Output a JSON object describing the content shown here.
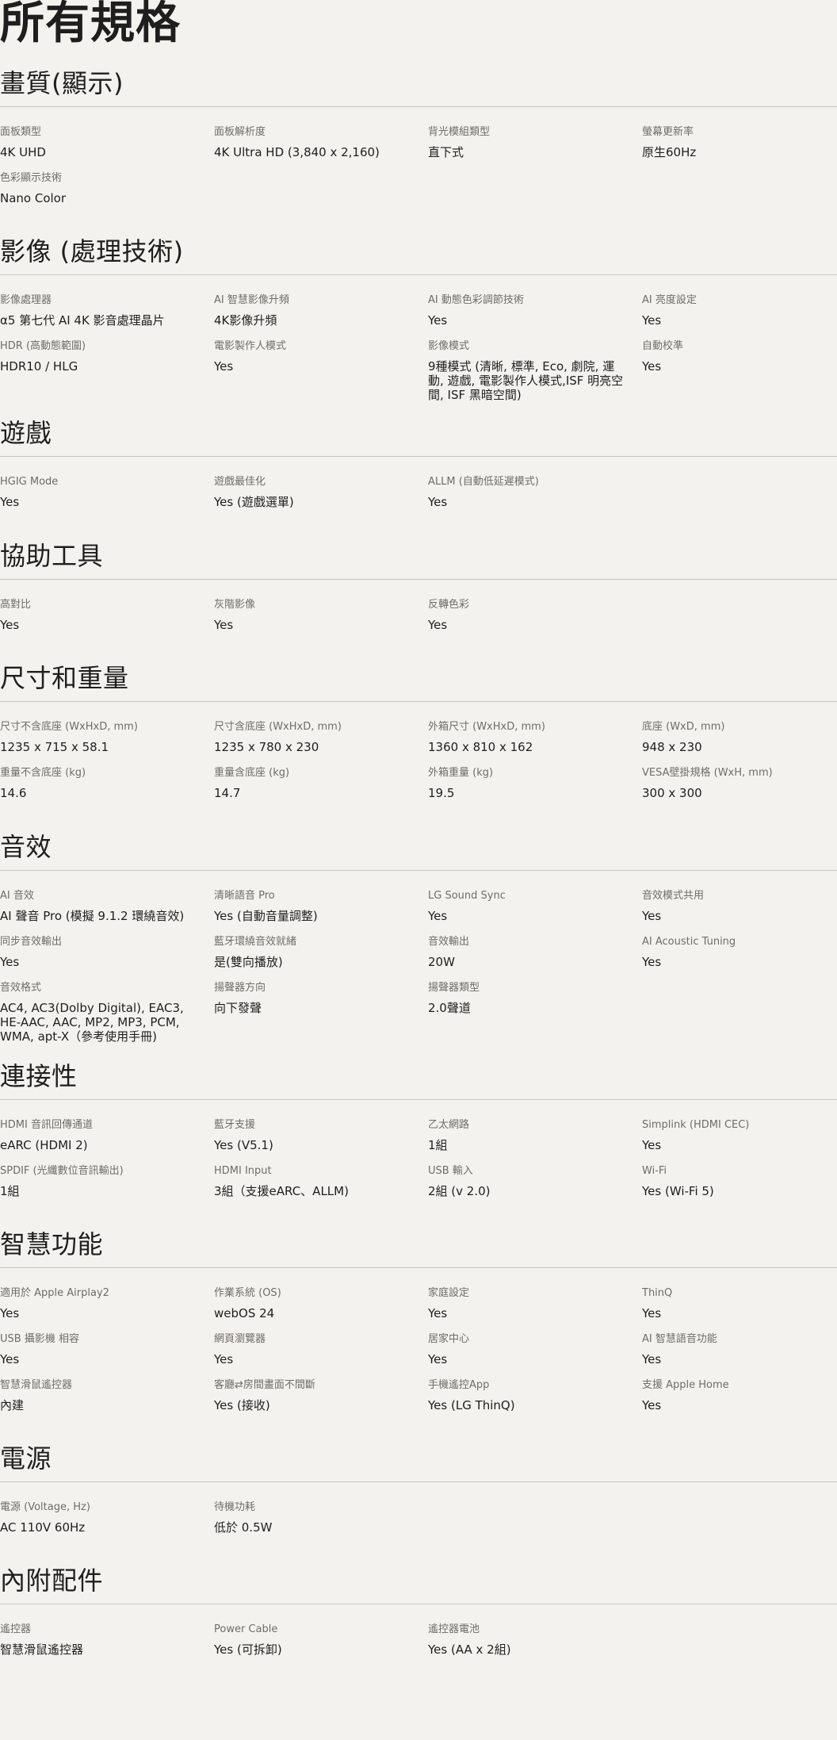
{
  "page_title": "所有規格",
  "sections": [
    {
      "title": "畫質(顯示)",
      "items": [
        {
          "label": "面板類型",
          "value": "4K UHD"
        },
        {
          "label": "面板解析度",
          "value": "4K Ultra HD (3,840 x 2,160)"
        },
        {
          "label": "背光模組類型",
          "value": "直下式"
        },
        {
          "label": "螢幕更新率",
          "value": "原生60Hz"
        },
        {
          "label": "色彩顯示技術",
          "value": "Nano Color"
        }
      ]
    },
    {
      "title": "影像 (處理技術)",
      "items": [
        {
          "label": "影像處理器",
          "value": "α5 第七代 AI 4K 影音處理晶片"
        },
        {
          "label": "AI 智慧影像升頻",
          "value": "4K影像升頻"
        },
        {
          "label": "AI 動態色彩調節技術",
          "value": "Yes"
        },
        {
          "label": "AI 亮度設定",
          "value": "Yes"
        },
        {
          "label": "HDR (高動態範圍)",
          "value": "HDR10 / HLG"
        },
        {
          "label": "電影製作人模式",
          "value": "Yes"
        },
        {
          "label": "影像模式",
          "value": "9種模式 (清晰, 標準, Eco, 劇院, 運動, 遊戲, 電影製作人模式,ISF 明亮空間, ISF 黑暗空間)"
        },
        {
          "label": "自動校準",
          "value": "Yes"
        }
      ]
    },
    {
      "title": "遊戲",
      "items": [
        {
          "label": "HGIG Mode",
          "value": "Yes"
        },
        {
          "label": "遊戲最佳化",
          "value": "Yes (遊戲選單)"
        },
        {
          "label": "ALLM (自動低延遲模式)",
          "value": "Yes"
        }
      ]
    },
    {
      "title": "協助工具",
      "items": [
        {
          "label": "高對比",
          "value": "Yes"
        },
        {
          "label": "灰階影像",
          "value": "Yes"
        },
        {
          "label": "反轉色彩",
          "value": "Yes"
        }
      ]
    },
    {
      "title": "尺寸和重量",
      "items": [
        {
          "label": "尺寸不含底座 (WxHxD, mm)",
          "value": "1235 x 715 x 58.1"
        },
        {
          "label": "尺寸含底座 (WxHxD, mm)",
          "value": "1235 x 780 x 230"
        },
        {
          "label": "外箱尺寸 (WxHxD, mm)",
          "value": "1360 x 810 x 162"
        },
        {
          "label": "底座 (WxD, mm)",
          "value": "948 x 230"
        },
        {
          "label": "重量不含底座 (kg)",
          "value": "14.6"
        },
        {
          "label": "重量含底座 (kg)",
          "value": "14.7"
        },
        {
          "label": "外箱重量 (kg)",
          "value": "19.5"
        },
        {
          "label": "VESA壁掛規格 (WxH, mm)",
          "value": "300 x 300"
        }
      ]
    },
    {
      "title": "音效",
      "items": [
        {
          "label": "AI 音效",
          "value": "AI 聲音 Pro (模擬 9.1.2 環繞音效)"
        },
        {
          "label": "清晰語音 Pro",
          "value": "Yes (自動音量調整)"
        },
        {
          "label": "LG Sound Sync",
          "value": "Yes"
        },
        {
          "label": "音效模式共用",
          "value": "Yes"
        },
        {
          "label": "同步音效輸出",
          "value": "Yes"
        },
        {
          "label": "藍牙環繞音效就緒",
          "value": "是(雙向播放)"
        },
        {
          "label": "音效輸出",
          "value": "20W"
        },
        {
          "label": "AI Acoustic Tuning",
          "value": "Yes"
        },
        {
          "label": "音效格式",
          "value": "AC4, AC3(Dolby Digital), EAC3, HE-AAC, AAC, MP2, MP3, PCM, WMA, apt-X（參考使用手冊)"
        },
        {
          "label": "揚聲器方向",
          "value": "向下發聲"
        },
        {
          "label": "揚聲器類型",
          "value": "2.0聲道"
        }
      ]
    },
    {
      "title": "連接性",
      "items": [
        {
          "label": "HDMI 音訊回傳通道",
          "value": "eARC (HDMI 2)"
        },
        {
          "label": "藍牙支援",
          "value": "Yes (V5.1)"
        },
        {
          "label": "乙太網路",
          "value": "1組"
        },
        {
          "label": "Simplink (HDMI CEC)",
          "value": "Yes"
        },
        {
          "label": "SPDIF (光纖數位音訊輸出)",
          "value": "1組"
        },
        {
          "label": "HDMI Input",
          "value": "3組（支援eARC、ALLM)"
        },
        {
          "label": "USB 輸入",
          "value": "2組 (v 2.0)"
        },
        {
          "label": "Wi-Fi",
          "value": "Yes (Wi-Fi 5)"
        }
      ]
    },
    {
      "title": "智慧功能",
      "items": [
        {
          "label": "適用於 Apple Airplay2",
          "value": "Yes"
        },
        {
          "label": "作業系統 (OS)",
          "value": "webOS 24"
        },
        {
          "label": "家庭設定",
          "value": "Yes"
        },
        {
          "label": "ThinQ",
          "value": "Yes"
        },
        {
          "label": "USB 攝影機 相容",
          "value": "Yes"
        },
        {
          "label": "網頁瀏覽器",
          "value": "Yes"
        },
        {
          "label": "居家中心",
          "value": "Yes"
        },
        {
          "label": "AI 智慧語音功能",
          "value": "Yes"
        },
        {
          "label": "智慧滑鼠遙控器",
          "value": "內建"
        },
        {
          "label": "客廳⇄房間畫面不間斷",
          "value": "Yes (接收)"
        },
        {
          "label": "手機遙控App",
          "value": "Yes (LG ThinQ)"
        },
        {
          "label": "支援 Apple Home",
          "value": "Yes"
        }
      ]
    },
    {
      "title": "電源",
      "items": [
        {
          "label": "電源 (Voltage, Hz)",
          "value": "AC 110V 60Hz"
        },
        {
          "label": "待機功耗",
          "value": "低於 0.5W"
        }
      ]
    },
    {
      "title": "內附配件",
      "items": [
        {
          "label": "遙控器",
          "value": "智慧滑鼠遙控器"
        },
        {
          "label": "Power Cable",
          "value": "Yes (可拆卸)"
        },
        {
          "label": "遙控器電池",
          "value": "Yes (AA x 2組)"
        }
      ]
    }
  ]
}
